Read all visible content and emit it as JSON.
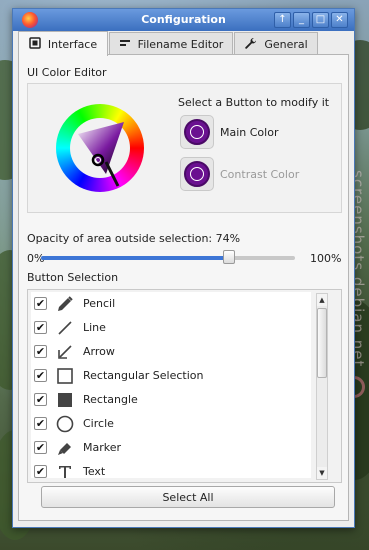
{
  "window": {
    "title": "Configuration",
    "buttons": {
      "up": "↑",
      "minimize": "_",
      "maximize": "□",
      "close": "✕"
    }
  },
  "tabs": [
    {
      "label": "Interface",
      "icon": "interface-icon",
      "active": true
    },
    {
      "label": "Filename Editor",
      "icon": "filename-editor-icon",
      "active": false
    },
    {
      "label": "General",
      "icon": "wrench-icon",
      "active": false
    }
  ],
  "interface": {
    "color_editor": {
      "heading": "UI Color Editor",
      "instruction": "Select a Button to modify it",
      "main_color_label": "Main Color",
      "contrast_color_label": "Contrast Color",
      "main_color": "#6a1090",
      "contrast_color": "#6a1090"
    },
    "opacity": {
      "label": "Opacity of area outside selection: 74%",
      "min_label": "0%",
      "max_label": "100%",
      "value": 0.74
    },
    "button_selection": {
      "heading": "Button Selection",
      "items": [
        {
          "label": "Pencil",
          "icon": "pencil-icon",
          "checked": true
        },
        {
          "label": "Line",
          "icon": "line-icon",
          "checked": true
        },
        {
          "label": "Arrow",
          "icon": "arrow-icon",
          "checked": true
        },
        {
          "label": "Rectangular Selection",
          "icon": "rectangular-selection-icon",
          "checked": true
        },
        {
          "label": "Rectangle",
          "icon": "rectangle-icon",
          "checked": true
        },
        {
          "label": "Circle",
          "icon": "circle-icon",
          "checked": true
        },
        {
          "label": "Marker",
          "icon": "marker-icon",
          "checked": true
        },
        {
          "label": "Text",
          "icon": "text-icon",
          "checked": true
        }
      ],
      "check_mark": "✔",
      "scroll_up": "▲",
      "scroll_down": "▼",
      "select_all_label": "Select All"
    }
  },
  "watermark": "screenshots.debian.net",
  "colors": {
    "titlebar": "#3b6fbf",
    "accent": "#3d76d6",
    "window_bg": "#ededed"
  }
}
